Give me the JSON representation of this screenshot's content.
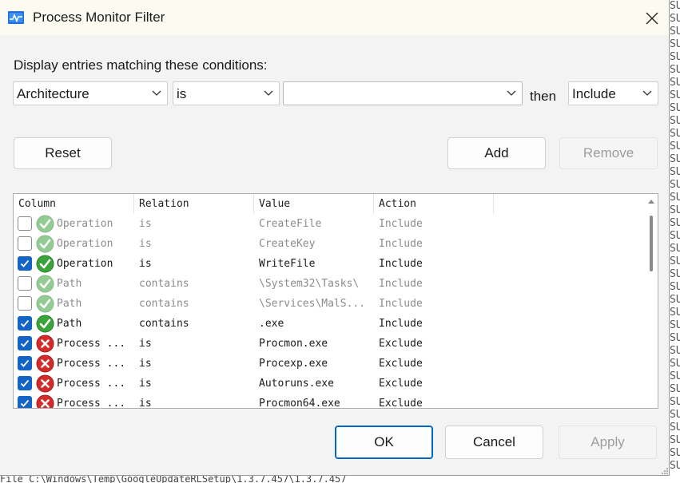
{
  "window": {
    "title": "Process Monitor Filter"
  },
  "filter": {
    "label": "Display entries matching these conditions:",
    "column_value": "Architecture",
    "relation_value": "is",
    "value_value": "",
    "then_label": "then",
    "action_value": "Include"
  },
  "buttons": {
    "reset": "Reset",
    "add": "Add",
    "remove": "Remove",
    "ok": "OK",
    "cancel": "Cancel",
    "apply": "Apply"
  },
  "list": {
    "headers": [
      "Column",
      "Relation",
      "Value",
      "Action"
    ],
    "rows": [
      {
        "enabled": false,
        "type": "include",
        "column": "Operation",
        "relation": "is",
        "value": "CreateFile",
        "action": "Include"
      },
      {
        "enabled": false,
        "type": "include",
        "column": "Operation",
        "relation": "is",
        "value": "CreateKey",
        "action": "Include"
      },
      {
        "enabled": true,
        "type": "include",
        "column": "Operation",
        "relation": "is",
        "value": "WriteFile",
        "action": "Include"
      },
      {
        "enabled": false,
        "type": "include",
        "column": "Path",
        "relation": "contains",
        "value": "\\System32\\Tasks\\",
        "action": "Include"
      },
      {
        "enabled": false,
        "type": "include",
        "column": "Path",
        "relation": "contains",
        "value": "\\Services\\MalS...",
        "action": "Include"
      },
      {
        "enabled": true,
        "type": "include",
        "column": "Path",
        "relation": "contains",
        "value": ".exe",
        "action": "Include"
      },
      {
        "enabled": true,
        "type": "exclude",
        "column": "Process ...",
        "relation": "is",
        "value": "Procmon.exe",
        "action": "Exclude"
      },
      {
        "enabled": true,
        "type": "exclude",
        "column": "Process ...",
        "relation": "is",
        "value": "Procexp.exe",
        "action": "Exclude"
      },
      {
        "enabled": true,
        "type": "exclude",
        "column": "Process ...",
        "relation": "is",
        "value": "Autoruns.exe",
        "action": "Exclude"
      },
      {
        "enabled": true,
        "type": "exclude",
        "column": "Process ...",
        "relation": "is",
        "value": "Procmon64.exe",
        "action": "Exclude"
      }
    ]
  },
  "background": {
    "side_text": [
      "SU",
      "SU",
      "SU",
      "SU",
      "SU",
      "SU",
      "SU",
      "SU",
      "SU",
      "SU",
      "SU",
      "SU",
      "SU",
      "SU",
      "SU",
      "SU",
      "SU",
      "SU",
      "SU",
      "SU",
      "SU",
      "SU",
      "SU",
      "SU",
      "SU",
      "SU",
      "SU",
      "SU",
      "SU",
      "SU",
      "SU",
      "SU",
      "SU",
      "SU",
      "SU",
      "SU",
      "SU"
    ],
    "bottom_text": "  File      C:\\Windows\\Temp\\GoogleUpdateRLSetup\\1.3.7.457\\1.3.7.457"
  },
  "icons": {
    "app": "process-monitor-icon",
    "include": "green-check-icon",
    "exclude": "red-x-icon",
    "close": "close-icon",
    "dropdown": "chevron-down-icon"
  },
  "colors": {
    "accent": "#0067c0",
    "checkbox_checked": "#1464c8",
    "include_green": "#3aa33a",
    "exclude_red": "#d42a2a"
  }
}
